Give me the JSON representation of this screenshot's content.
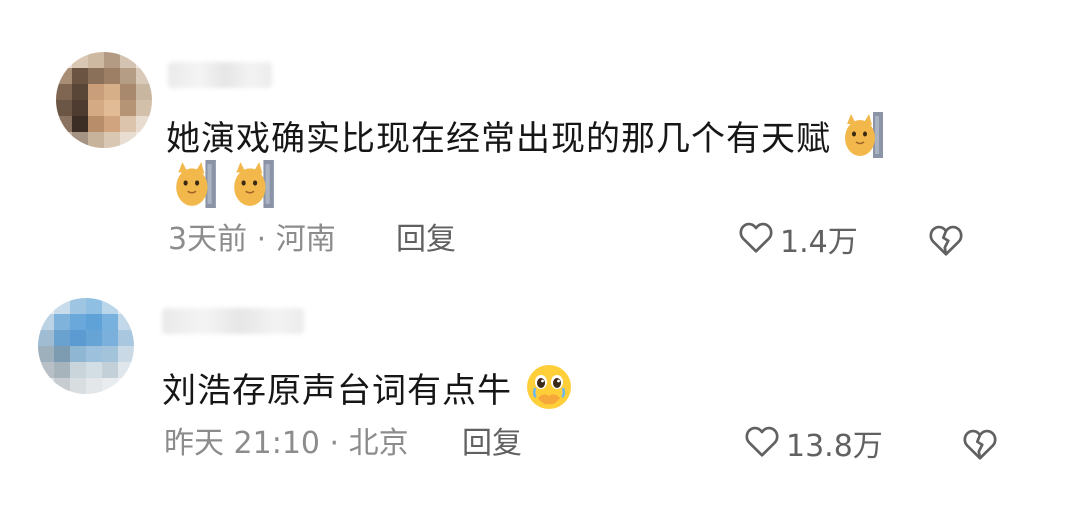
{
  "comments": [
    {
      "text": "她演戏确实比现在经常出现的那几个有天赋",
      "emoji_inline": "cat-peek-emoji",
      "emoji_followups": [
        "cat-peek-emoji",
        "cat-peek-emoji"
      ],
      "meta": "3天前 · 河南",
      "reply_label": "回复",
      "like_count": "1.4万",
      "like_icon": "heart-outline-icon",
      "dislike_icon": "broken-heart-icon"
    },
    {
      "text": "刘浩存原声台词有点牛",
      "emoji_inline": "pleading-hands-emoji",
      "meta": "昨天 21:10 · 北京",
      "reply_label": "回复",
      "like_count": "13.8万",
      "like_icon": "heart-outline-icon",
      "dislike_icon": "broken-heart-icon"
    }
  ],
  "colors": {
    "text": "#161616",
    "meta": "#8c8c8c",
    "action": "#616161"
  }
}
